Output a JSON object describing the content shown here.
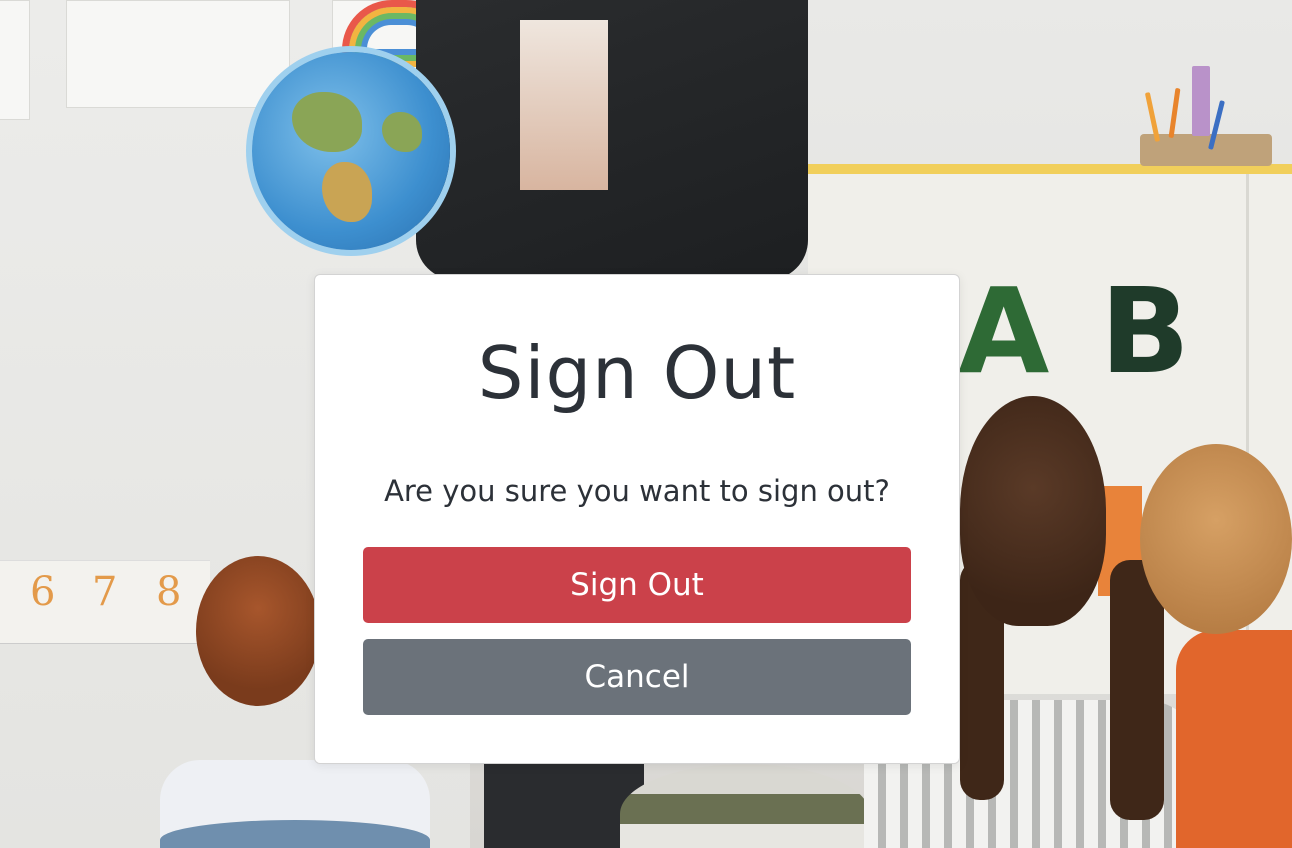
{
  "modal": {
    "title": "Sign Out",
    "message": "Are you sure you want to sign out?",
    "confirm_label": "Sign Out",
    "cancel_label": "Cancel"
  },
  "background": {
    "alphabet_letters": [
      "A",
      "B"
    ],
    "number_strip": [
      "6",
      "7",
      "8"
    ]
  },
  "colors": {
    "confirm_button": "#cb414a",
    "cancel_button": "#6b727a",
    "modal_background": "#ffffff",
    "title_text": "#2c3138"
  }
}
